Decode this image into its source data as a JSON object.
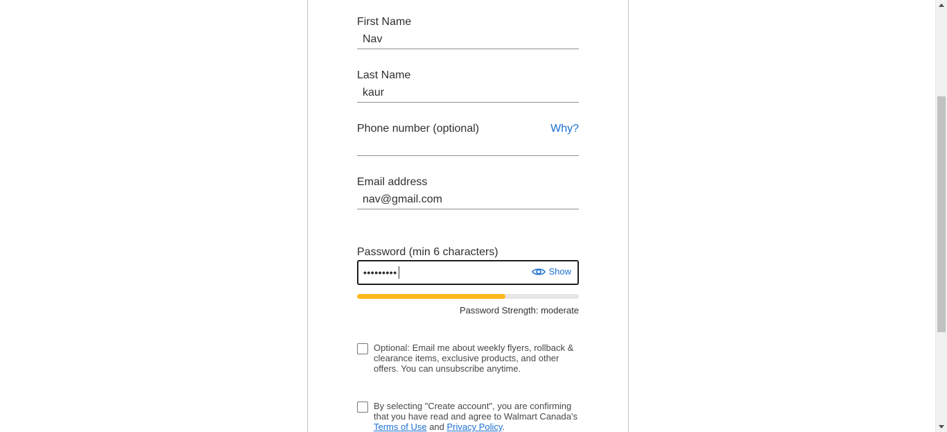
{
  "form": {
    "first_name": {
      "label": "First Name",
      "value": "Nav"
    },
    "last_name": {
      "label": "Last Name",
      "value": "kaur"
    },
    "phone": {
      "label": "Phone number (optional)",
      "value": "",
      "help_link": "Why?"
    },
    "email": {
      "label": "Email address",
      "value": "nav@gmail.com"
    },
    "password": {
      "label": "Password (min 6 characters)",
      "masked_value": "•••••••••",
      "show_label": "Show"
    },
    "strength": {
      "text": "Password Strength: moderate",
      "percent": 67,
      "color": "#ffb81c"
    },
    "optin": {
      "text": "Optional: Email me about weekly flyers, rollback & clearance items, exclusive products, and other offers. You can unsubscribe anytime.",
      "checked": false
    },
    "terms": {
      "text_before": "By selecting \"Create account\", you are confirming that you have read and agree to Walmart Canada's ",
      "terms_link": "Terms of Use",
      "and": " and ",
      "privacy_link": "Privacy Policy",
      "period": ".",
      "checked": false
    }
  },
  "icons": {
    "show": "eye-icon"
  },
  "colors": {
    "link": "#1a6fd1",
    "accent": "#ffb81c"
  }
}
